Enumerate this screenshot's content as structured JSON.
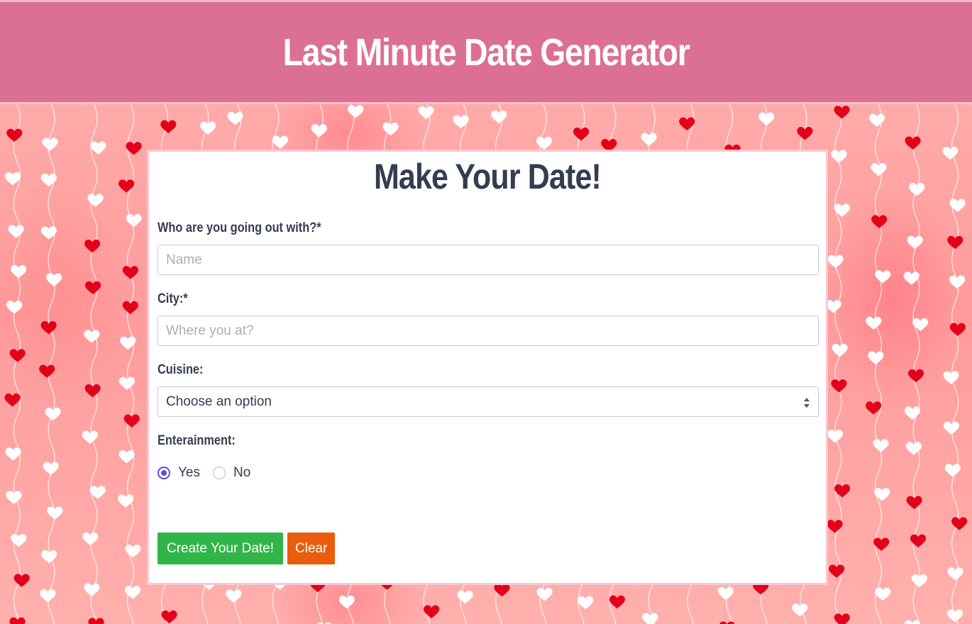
{
  "header": {
    "title": "Last Minute Date Generator"
  },
  "form": {
    "heading": "Make Your Date!",
    "name_label": "Who are you going out with?*",
    "name_placeholder": "Name",
    "name_value": "",
    "city_label": "City:*",
    "city_placeholder": "Where you at?",
    "city_value": "",
    "cuisine_label": "Cuisine:",
    "cuisine_selected": "Choose an option",
    "entertainment_label": "Enterainment:",
    "entertainment_options": [
      {
        "label": "Yes",
        "checked": true
      },
      {
        "label": "No",
        "checked": false
      }
    ],
    "create_button": "Create Your Date!",
    "clear_button": "Clear"
  },
  "colors": {
    "header_bg": "#dc7093",
    "heading_text": "#343d4f",
    "create_button": "#32b548",
    "clear_button": "#ea5d0c",
    "radio_accent": "#5a4fd4",
    "heart_red": "#e3001a",
    "heart_white": "#ffffff"
  },
  "background": {
    "pattern": "hanging-hearts"
  }
}
